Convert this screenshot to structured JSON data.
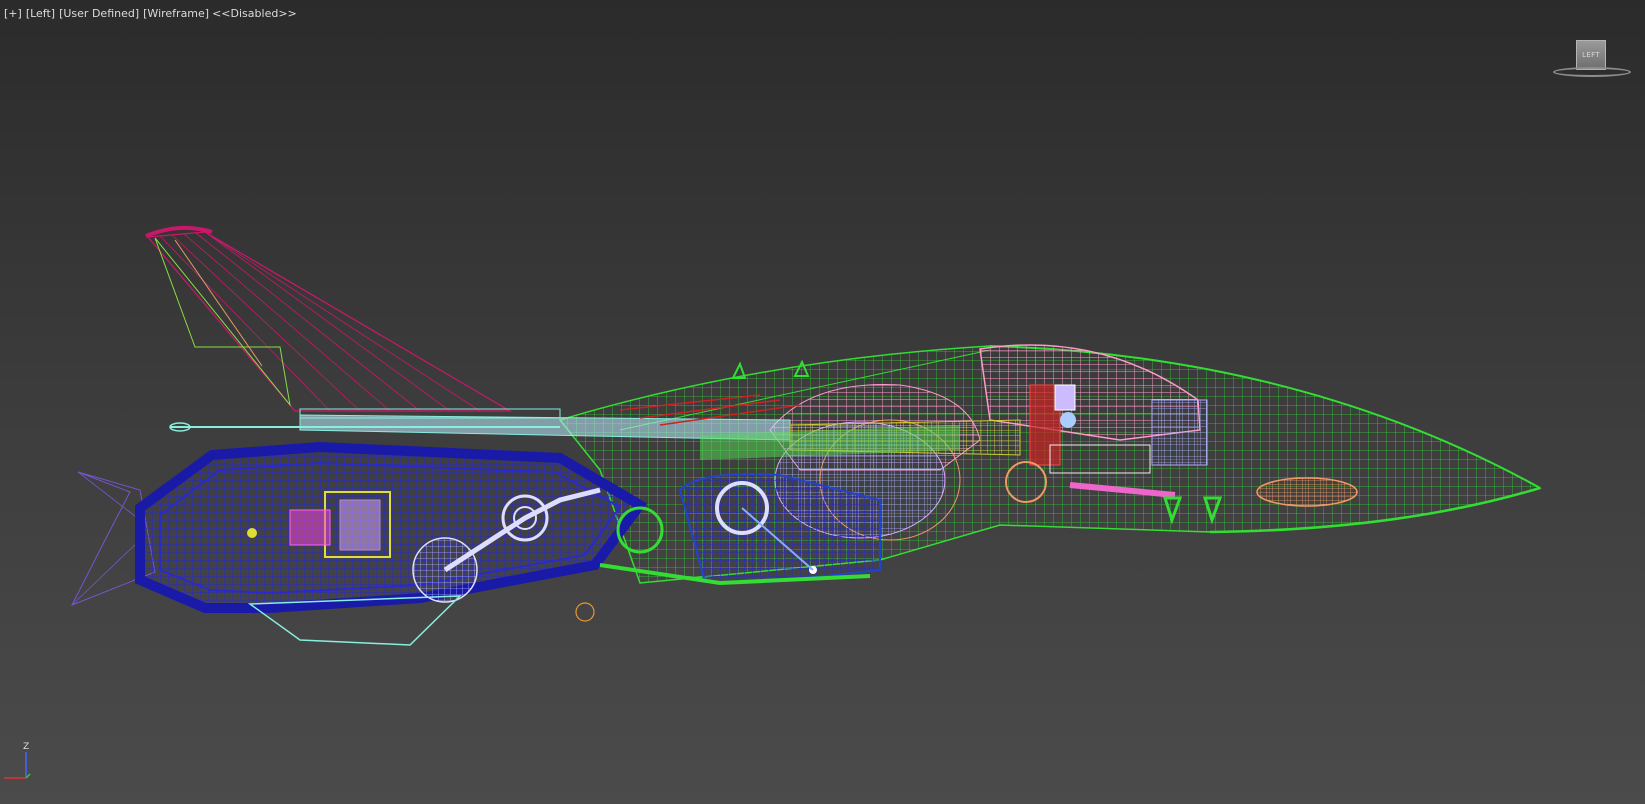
{
  "viewport": {
    "label_plus": "[+]",
    "label_view": "[Left]",
    "label_shading": "[User Defined]",
    "label_mode": "[Wireframe]",
    "label_status": "<<Disabled>>"
  },
  "viewcube": {
    "face": "LEFT"
  },
  "axis": {
    "z": "Z"
  },
  "colors": {
    "background_top": "#2b2b2b",
    "background_bottom": "#4b4b4b",
    "wire_green": "#33dd33",
    "wire_blue": "#1a1aa8",
    "wire_pink": "#ff99cc",
    "wire_magenta": "#c8186a",
    "wire_lavender": "#9999ee",
    "wire_yellow": "#cccc33",
    "wire_cyan": "#88eedd",
    "wire_red": "#cc2222",
    "wire_orange": "#e69966"
  }
}
